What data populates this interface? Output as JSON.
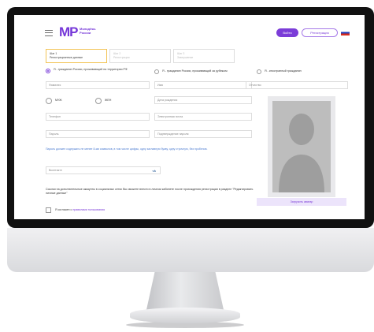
{
  "header": {
    "logo_mark": "MP",
    "logo_line1": "Молодёжь",
    "logo_line2": "России",
    "login_label": "Войти",
    "register_label": "Регистрация"
  },
  "steps": [
    {
      "title": "Шаг 1",
      "subtitle": "Регистрационные данные"
    },
    {
      "title": "Шаг 2",
      "subtitle": "Регистрация"
    },
    {
      "title": "Шаг 3",
      "subtitle": "Завершение"
    }
  ],
  "citizenship": {
    "option1": "Я - гражданин России, проживающий на территории РФ",
    "option2": "Я - гражданин России, проживающий за рубежом",
    "option3": "Я - иностранный гражданин"
  },
  "fields": {
    "surname": "Фамилия",
    "name": "Имя",
    "patronymic": "Отчество",
    "male": "МУЖ",
    "female": "ЖЕН",
    "birthdate": "Дата рождения",
    "phone": "Телефон",
    "email": "Электронная почта",
    "password": "Пароль",
    "password_confirm": "Подтверждение пароля"
  },
  "password_note": "Пароль должен содержать не менее 8-ми символов, в том числе цифры, одну заглавную букву, одну строчную, без пробелов.",
  "vk": {
    "placeholder": "Вконтакте",
    "icon": "vk-icon"
  },
  "social_info": "Ссылки на дополнительные аккаунты в социальных сетях Вы сможете внести в личном кабинете после прохождения регистрации в разделе \"Редактировать личные данные\"",
  "agree": {
    "text": "Я согласен с",
    "link": "правилами пользования"
  },
  "upload_label": "Загрузить аватар",
  "colors": {
    "accent": "#7a3bd8",
    "step_active": "#f2c14e",
    "note": "#4a7ad0"
  }
}
